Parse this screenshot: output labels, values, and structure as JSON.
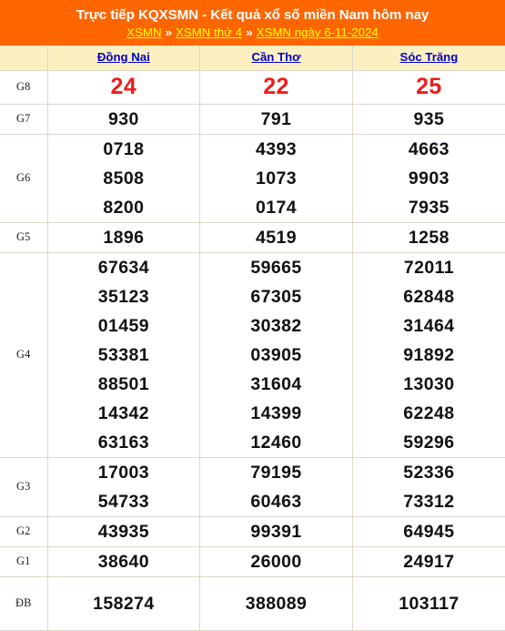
{
  "banner": {
    "title": "Trực tiếp KQXSMN - Kết quả xổ số miền Nam hôm nay",
    "breadcrumb": [
      {
        "label": "XSMN"
      },
      {
        "label": "XSMN thứ 4"
      },
      {
        "label": "XSMN ngày 6-11-2024"
      }
    ],
    "separator": "»"
  },
  "colors": {
    "banner_bg": "#ff6600",
    "banner_title": "#ffffff",
    "breadcrumb_link": "#ffff00",
    "province_header_bg": "#fdf0c0",
    "province_link": "#0000cc",
    "highlight_number": "#ee1c1c",
    "number": "#111111",
    "grid_line": "#ddd7cc"
  },
  "table": {
    "corner_label": "",
    "provinces": [
      {
        "name": "Đồng Nai"
      },
      {
        "name": "Cần Thơ"
      },
      {
        "name": "Sóc Trăng"
      }
    ],
    "rows": [
      {
        "prize": "G8",
        "highlight": true,
        "values": [
          [
            "24"
          ],
          [
            "22"
          ],
          [
            "25"
          ]
        ]
      },
      {
        "prize": "G7",
        "highlight": false,
        "values": [
          [
            "930"
          ],
          [
            "791"
          ],
          [
            "935"
          ]
        ]
      },
      {
        "prize": "G6",
        "highlight": false,
        "values": [
          [
            "0718",
            "8508",
            "8200"
          ],
          [
            "4393",
            "1073",
            "0174"
          ],
          [
            "4663",
            "9903",
            "7935"
          ]
        ]
      },
      {
        "prize": "G5",
        "highlight": false,
        "values": [
          [
            "1896"
          ],
          [
            "4519"
          ],
          [
            "1258"
          ]
        ]
      },
      {
        "prize": "G4",
        "highlight": false,
        "values": [
          [
            "67634",
            "35123",
            "01459",
            "53381",
            "88501",
            "14342",
            "63163"
          ],
          [
            "59665",
            "67305",
            "30382",
            "03905",
            "31604",
            "14399",
            "12460"
          ],
          [
            "72011",
            "62848",
            "31464",
            "91892",
            "13030",
            "62248",
            "59296"
          ]
        ]
      },
      {
        "prize": "G3",
        "highlight": false,
        "values": [
          [
            "17003",
            "54733"
          ],
          [
            "79195",
            "60463"
          ],
          [
            "52336",
            "73312"
          ]
        ]
      },
      {
        "prize": "G2",
        "highlight": false,
        "values": [
          [
            "43935"
          ],
          [
            "99391"
          ],
          [
            "64945"
          ]
        ]
      },
      {
        "prize": "G1",
        "highlight": false,
        "values": [
          [
            "38640"
          ],
          [
            "26000"
          ],
          [
            "24917"
          ]
        ]
      },
      {
        "prize": "ĐB",
        "highlight": true,
        "values": [
          [
            "158274"
          ],
          [
            "388089"
          ],
          [
            "103117"
          ]
        ]
      }
    ]
  }
}
